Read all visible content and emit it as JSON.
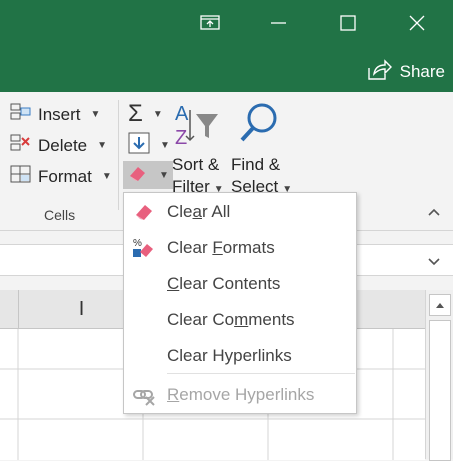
{
  "window": {
    "share_label": "Share"
  },
  "ribbon": {
    "insert_label": "Insert",
    "delete_label": "Delete",
    "format_label": "Format",
    "group_label": "Cells",
    "sort_filter_line1": "Sort &",
    "sort_filter_line2": "Filter",
    "find_select_line1": "Find &",
    "find_select_line2": "Select"
  },
  "sheet": {
    "column_letter": "I"
  },
  "clear_menu": {
    "items": [
      {
        "pre": "Cle",
        "key": "a",
        "post": "r All",
        "enabled": true,
        "icon": "eraser-icon"
      },
      {
        "pre": "Clear ",
        "key": "F",
        "post": "ormats",
        "enabled": true,
        "icon": "clear-formats-icon"
      },
      {
        "pre": "",
        "key": "C",
        "post": "lear Contents",
        "enabled": true,
        "icon": ""
      },
      {
        "pre": "Clear Co",
        "key": "m",
        "post": "ments",
        "enabled": true,
        "icon": ""
      },
      {
        "pre": "Clear Hyperlinks",
        "key": "",
        "post": "",
        "enabled": true,
        "icon": ""
      },
      {
        "pre": "",
        "key": "R",
        "post": "emove Hyperlinks",
        "enabled": false,
        "icon": "remove-hyperlink-icon"
      }
    ]
  },
  "colors": {
    "title_bar": "#217346",
    "eraser": "#e8607e",
    "menu_border": "#c6c6c6"
  }
}
